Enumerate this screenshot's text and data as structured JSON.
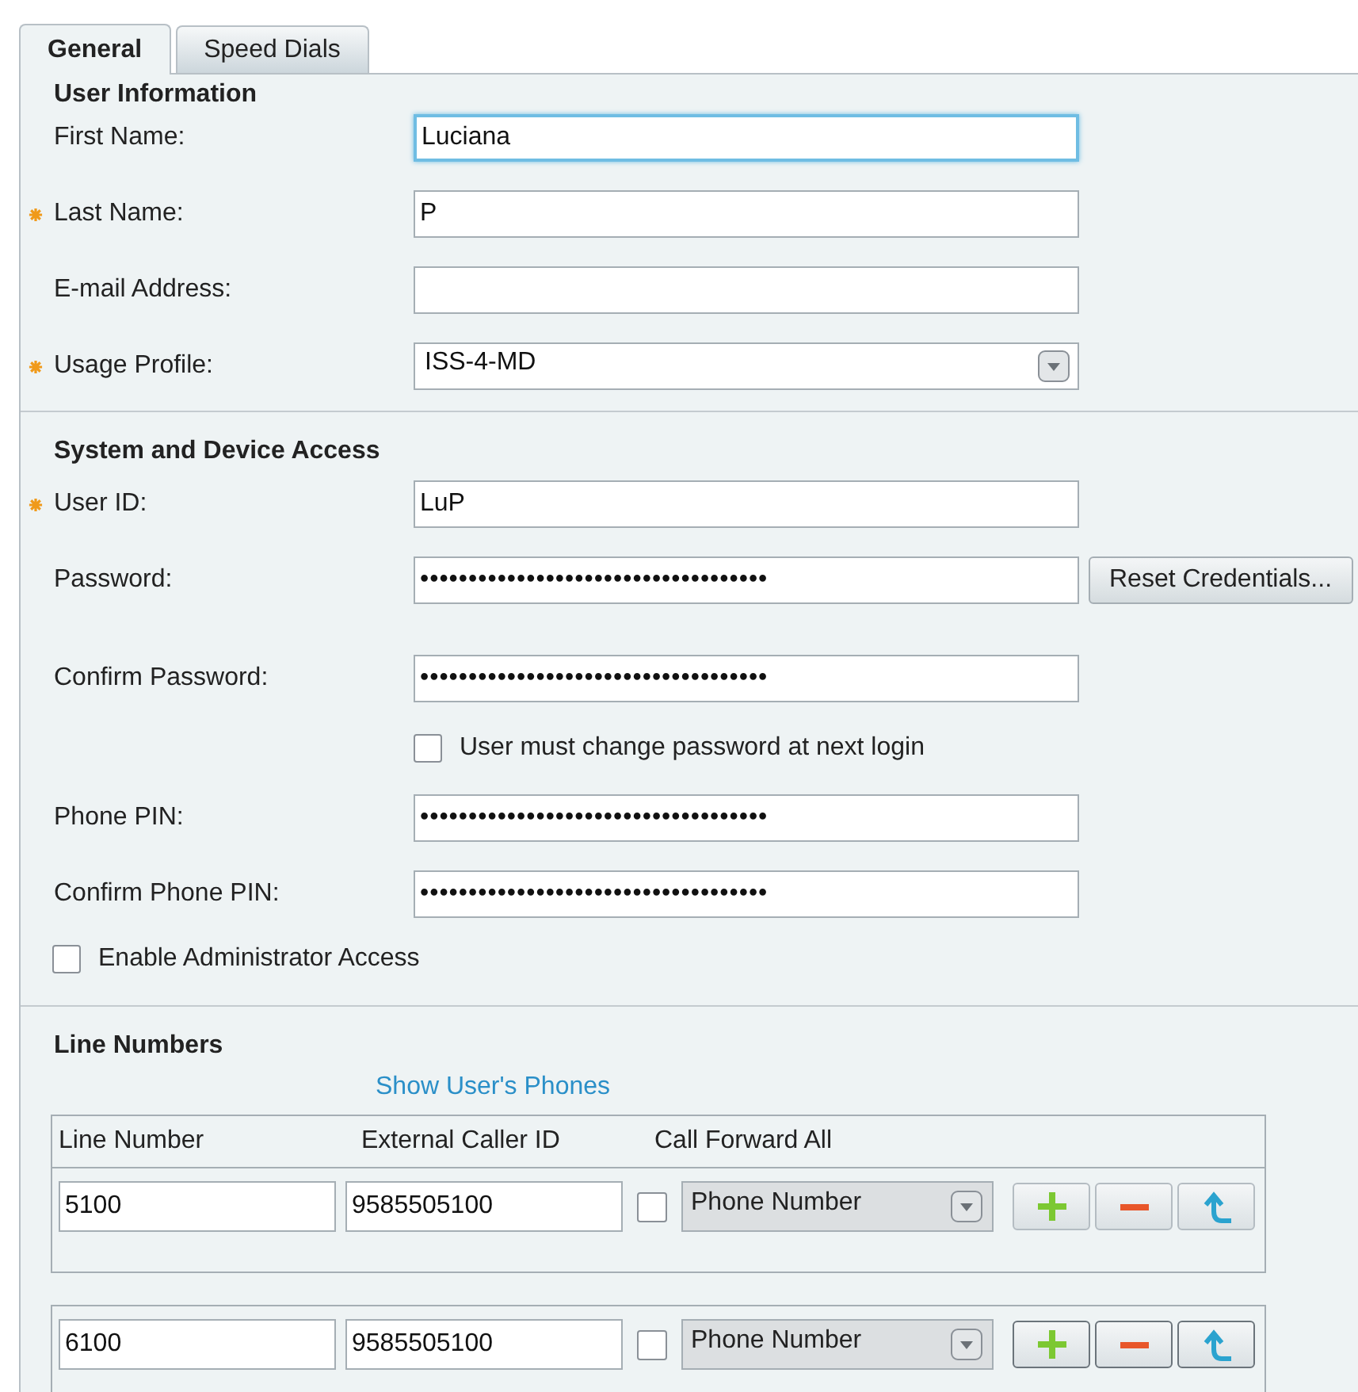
{
  "tabs": [
    {
      "label": "General",
      "selected": true
    },
    {
      "label": "Speed Dials",
      "selected": false
    }
  ],
  "user_information": {
    "heading": "User Information",
    "fields": [
      {
        "kind": "text",
        "label": "First Name:",
        "required": false,
        "focused": true,
        "value": "Luciana"
      },
      {
        "kind": "text",
        "label": "Last Name:",
        "required": true,
        "focused": false,
        "value": "P"
      },
      {
        "kind": "text",
        "label": "E-mail Address:",
        "required": false,
        "focused": false
      },
      {
        "kind": "select",
        "label": "Usage Profile:",
        "required": true,
        "focused": false,
        "value": "ISS-4-MD"
      }
    ]
  },
  "system_access": {
    "heading": "System and Device Access",
    "fields": [
      {
        "kind": "text",
        "label": "User ID:",
        "required": true,
        "value": "LuP"
      },
      {
        "kind": "password",
        "label": "Password:",
        "required": false,
        "value": "••••••••••••••••••••••••••••••••••••",
        "button": "Reset Credentials..."
      },
      {
        "kind": "password",
        "label": "Confirm Password:",
        "required": false,
        "value": "••••••••••••••••••••••••••••••••••••"
      }
    ],
    "must_change_checkbox": {
      "label": "User must change password at next login",
      "checked": false
    },
    "pin_fields": [
      {
        "kind": "password",
        "label": "Phone PIN:",
        "required": false,
        "value": "••••••••••••••••••••••••••••••••••••"
      },
      {
        "kind": "password",
        "label": "Confirm Phone PIN:",
        "required": false,
        "value": "••••••••••••••••••••••••••••••••••••"
      }
    ],
    "admin_checkbox": {
      "label": "Enable Administrator Access",
      "checked": false
    }
  },
  "line_numbers": {
    "heading": "Line Numbers",
    "link": "Show User's Phones",
    "columns": [
      "Line Number",
      "External Caller ID",
      "Call Forward All"
    ],
    "rows": [
      {
        "line_number": "5100",
        "caller_id": "9585505100",
        "forward_all": false,
        "forward_type": "Phone Number"
      },
      {
        "line_number": "6100",
        "caller_id": "9585505100",
        "forward_all": false,
        "forward_type": "Phone Number"
      }
    ]
  }
}
